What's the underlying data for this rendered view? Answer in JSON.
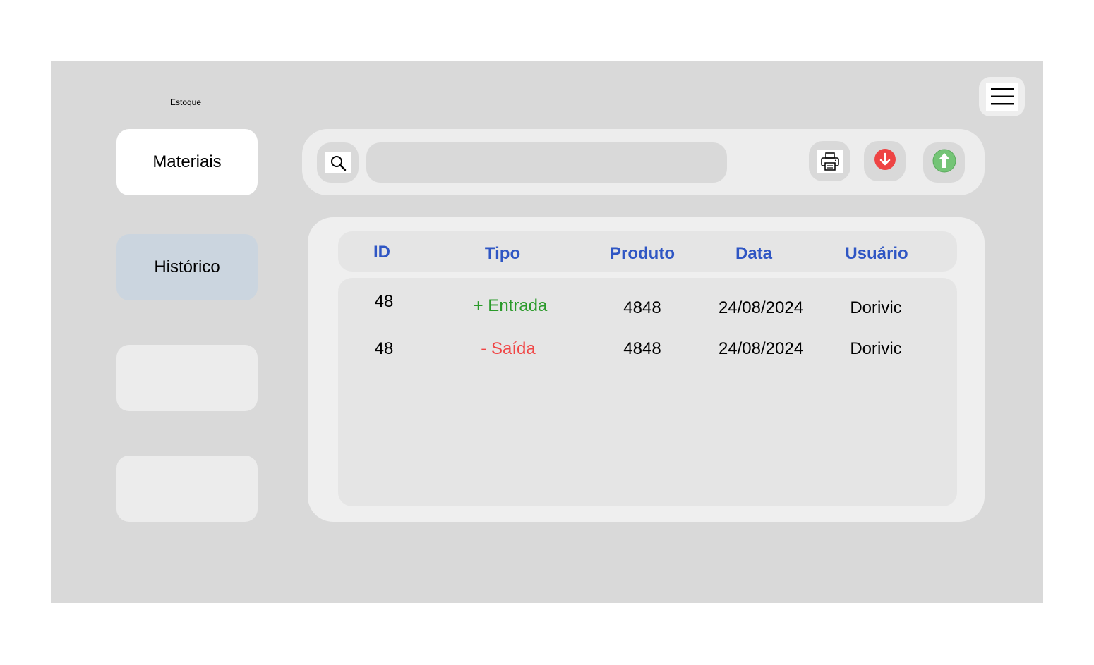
{
  "app": {
    "title": "Estoque"
  },
  "sidebar": {
    "items": [
      {
        "label": "Materiais",
        "state": "active"
      },
      {
        "label": "Histórico",
        "state": "selected"
      },
      {
        "label": "",
        "state": "empty"
      },
      {
        "label": "",
        "state": "empty"
      }
    ]
  },
  "toolbar": {
    "search_placeholder": "",
    "search_value": "",
    "icons": {
      "search": "search-icon",
      "print": "printer-icon",
      "out": "arrow-down-red-icon",
      "in": "arrow-up-green-icon",
      "menu": "hamburger-menu-icon"
    }
  },
  "table": {
    "columns": [
      "ID",
      "Tipo",
      "Produto",
      "Data",
      "Usuário"
    ],
    "rows": [
      {
        "id": "48",
        "tipo": "+ Entrada",
        "produto": "4848",
        "data": "24/08/2024",
        "usuario": "Dorivic"
      },
      {
        "id": "48",
        "tipo": "- Saída",
        "produto": "4848",
        "data": "24/08/2024",
        "usuario": "Dorivic"
      }
    ]
  },
  "colors": {
    "header_text": "#2f56c4",
    "entrada": "#2a9a2a",
    "saida": "#f04545",
    "background": "#d9d9d9",
    "nav_selected": "#cbd5df"
  }
}
